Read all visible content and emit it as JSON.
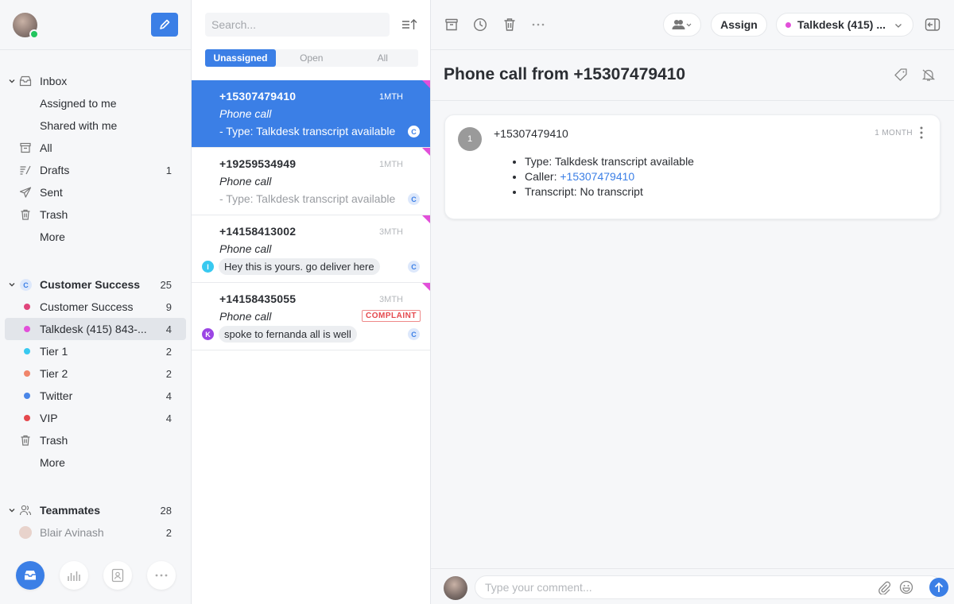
{
  "sidebar": {
    "compose_label": "Compose",
    "inbox": {
      "label": "Inbox",
      "items": [
        {
          "label": "Assigned to me",
          "count": ""
        },
        {
          "label": "Shared with me",
          "count": ""
        },
        {
          "label": "All",
          "count": "",
          "icon": "archive-icon"
        },
        {
          "label": "Drafts",
          "count": "1",
          "icon": "drafts-icon"
        },
        {
          "label": "Sent",
          "count": "",
          "icon": "sent-icon"
        },
        {
          "label": "Trash",
          "count": "",
          "icon": "trash-icon"
        },
        {
          "label": "More",
          "count": ""
        }
      ]
    },
    "team": {
      "badge": "C",
      "label": "Customer Success",
      "count": "25",
      "items": [
        {
          "label": "Customer Success",
          "count": "9",
          "color": "#e0457b"
        },
        {
          "label": "Talkdesk (415) 843-...",
          "count": "4",
          "color": "#e24fd9",
          "selected": true
        },
        {
          "label": "Tier 1",
          "count": "2",
          "color": "#38c9f0"
        },
        {
          "label": "Tier 2",
          "count": "2",
          "color": "#f0856b"
        },
        {
          "label": "Twitter",
          "count": "4",
          "color": "#4a86e8"
        },
        {
          "label": "VIP",
          "count": "4",
          "color": "#e5484d"
        },
        {
          "label": "Trash",
          "count": ""
        },
        {
          "label": "More",
          "count": ""
        }
      ]
    },
    "teammates": {
      "label": "Teammates",
      "count": "28",
      "items": [
        {
          "label": "Blair Avinash",
          "count": "2"
        }
      ]
    },
    "bottom_nav": [
      "inbox-icon",
      "analytics-icon",
      "contacts-icon",
      "more-icon"
    ]
  },
  "conversation_list": {
    "search_placeholder": "Search...",
    "tabs": [
      {
        "label": "Unassigned",
        "active": true
      },
      {
        "label": "Open",
        "active": false
      },
      {
        "label": "All",
        "active": false
      }
    ],
    "conversations": [
      {
        "from": "+15307479410",
        "time": "1MTH",
        "subject": "Phone call",
        "preview": "- Type: Talkdesk transcript available",
        "inbox_badge": "C",
        "active": true
      },
      {
        "from": "+19259534949",
        "time": "1MTH",
        "subject": "Phone call",
        "preview": "- Type: Talkdesk transcript available",
        "inbox_badge": "C",
        "active": false
      },
      {
        "from": "+14158413002",
        "time": "3MTH",
        "subject": "Phone call",
        "comment": "Hey this is yours. go deliver here",
        "author": "I",
        "author_color": "#38c9f0",
        "inbox_badge": "C",
        "active": false
      },
      {
        "from": "+14158435055",
        "time": "3MTH",
        "subject": "Phone call",
        "comment": "spoke to fernanda all is well",
        "author": "K",
        "author_color": "#9b45e4",
        "tag": "COMPLAINT",
        "inbox_badge": "C",
        "active": false
      }
    ]
  },
  "toolbar": {
    "assign_label": "Assign",
    "inbox_selector": {
      "label": "Talkdesk (415) ...",
      "color": "#e24fd9"
    }
  },
  "conversation": {
    "title": "Phone call from +15307479410",
    "message": {
      "index": "1",
      "from": "+15307479410",
      "time": "1 MONTH",
      "lines": [
        {
          "label": "Type: ",
          "value": "Talkdesk transcript available"
        },
        {
          "label": "Caller: ",
          "value": "+15307479410",
          "link": true
        },
        {
          "label": "Transcript: ",
          "value": "No transcript"
        }
      ]
    },
    "composer_placeholder": "Type your comment..."
  }
}
